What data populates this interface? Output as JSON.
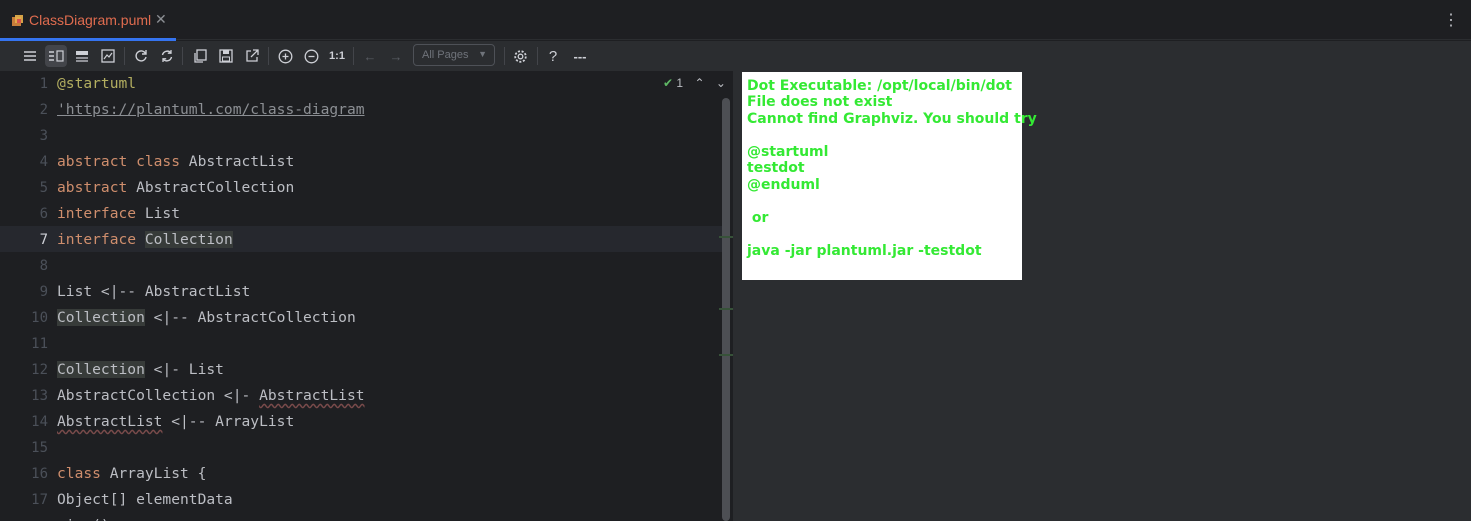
{
  "tab": {
    "file_name": "ClassDiagram.puml",
    "close_glyph": "✕"
  },
  "toolbar": {
    "all_pages": "All Pages",
    "zoom_reset": "1:1",
    "help": "?",
    "more": "---"
  },
  "inspection": {
    "count": "1"
  },
  "editor": {
    "current_line": 7,
    "lines": [
      {
        "no": "1",
        "text": "@startuml"
      },
      {
        "no": "2",
        "text": "'https://plantuml.com/class-diagram"
      },
      {
        "no": "3",
        "text": ""
      },
      {
        "no": "4",
        "text": "abstract class AbstractList"
      },
      {
        "no": "5",
        "text": "abstract AbstractCollection"
      },
      {
        "no": "6",
        "text": "interface List"
      },
      {
        "no": "7",
        "text": "interface Collection"
      },
      {
        "no": "8",
        "text": ""
      },
      {
        "no": "9",
        "text": "List <|-- AbstractList"
      },
      {
        "no": "10",
        "text": "Collection <|-- AbstractCollection"
      },
      {
        "no": "11",
        "text": ""
      },
      {
        "no": "12",
        "text": "Collection <|- List"
      },
      {
        "no": "13",
        "text": "AbstractCollection <|- AbstractList"
      },
      {
        "no": "14",
        "text": "AbstractList <|-- ArrayList"
      },
      {
        "no": "15",
        "text": ""
      },
      {
        "no": "16",
        "text": "class ArrayList {"
      },
      {
        "no": "17",
        "text": "Object[] elementData"
      }
    ]
  },
  "preview": {
    "lines": [
      "Dot Executable: /opt/local/bin/dot",
      "File does not exist",
      "Cannot find Graphviz. You should try",
      "",
      "@startuml",
      "testdot",
      "@enduml",
      "",
      " or",
      "",
      "java -jar plantuml.jar -testdot"
    ]
  },
  "colors": {
    "editor_bg": "#1e1f22",
    "keyword": "#cf8e6d",
    "annotation": "#b3ae60",
    "preview_text": "#34e934",
    "tab_accent": "#3574f0"
  }
}
